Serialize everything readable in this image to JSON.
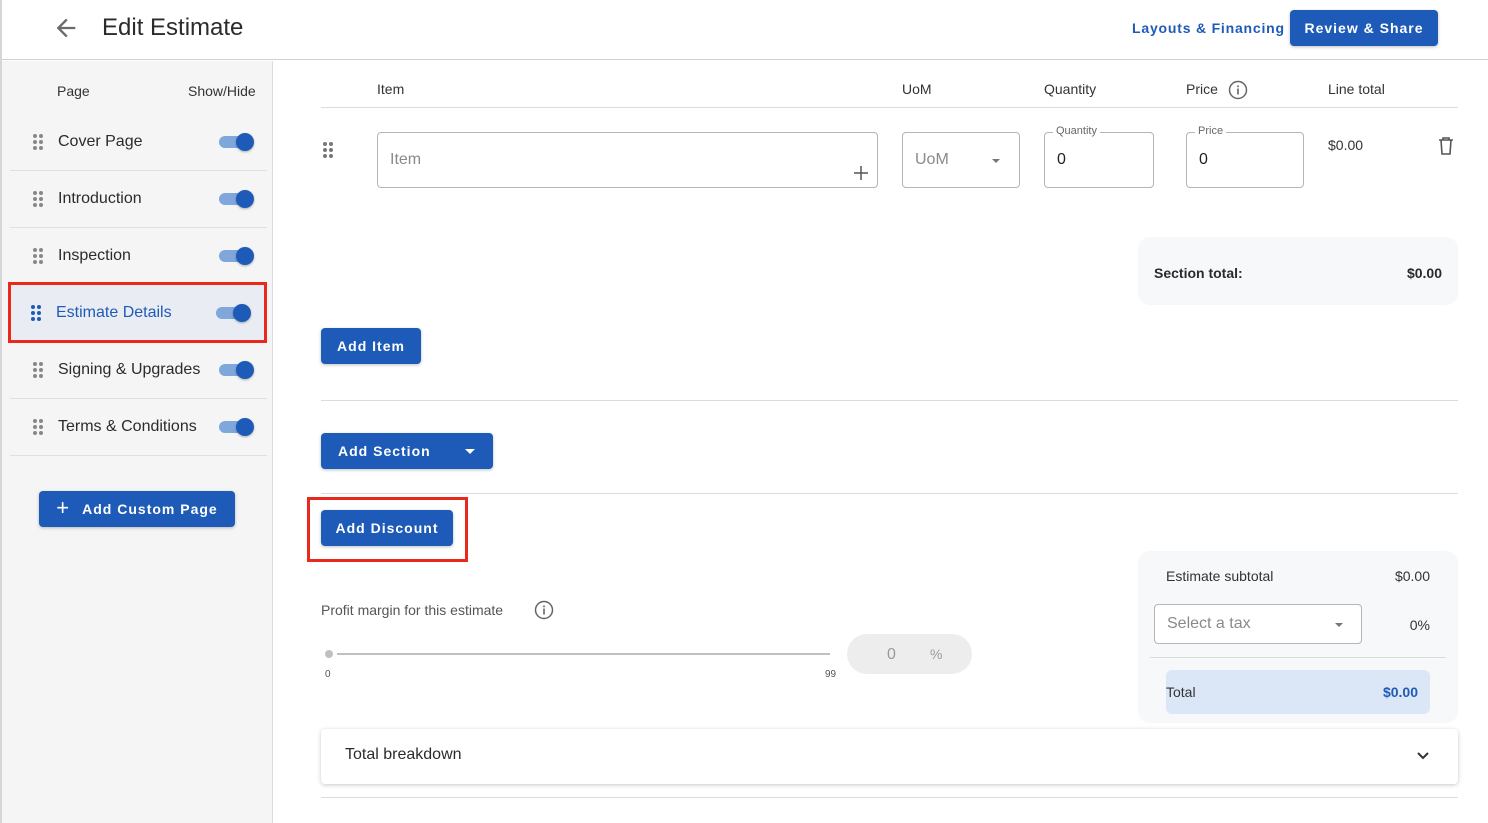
{
  "header": {
    "title": "Edit Estimate",
    "layouts_label": "Layouts & Financing",
    "review_label": "Review & Share",
    "accent": "#1e5bb8"
  },
  "sidebar": {
    "col_page": "Page",
    "col_show_hide": "Show/Hide",
    "items": [
      {
        "label": "Cover Page",
        "enabled": true
      },
      {
        "label": "Introduction",
        "enabled": true
      },
      {
        "label": "Inspection",
        "enabled": true
      },
      {
        "label": "Estimate Details",
        "enabled": true,
        "active": true
      },
      {
        "label": "Signing & Upgrades",
        "enabled": true
      },
      {
        "label": "Terms & Conditions",
        "enabled": true
      }
    ],
    "add_custom_label": "Add Custom Page"
  },
  "table": {
    "headers": {
      "item": "Item",
      "uom": "UoM",
      "quantity": "Quantity",
      "price": "Price",
      "line_total": "Line total"
    },
    "row": {
      "item_placeholder": "Item",
      "uom_placeholder": "UoM",
      "quantity_legend": "Quantity",
      "quantity_value": "0",
      "price_legend": "Price",
      "price_value": "0",
      "line_total": "$0.00"
    },
    "section_total_label": "Section total:",
    "section_total_value": "$0.00"
  },
  "actions": {
    "add_item": "Add Item",
    "add_section": "Add Section",
    "add_discount": "Add Discount"
  },
  "profit": {
    "label": "Profit margin for this estimate",
    "min": "0",
    "max": "99",
    "value": "0",
    "unit": "%"
  },
  "summary": {
    "subtotal_label": "Estimate subtotal",
    "subtotal_value": "$0.00",
    "tax_placeholder": "Select a tax",
    "tax_value": "0%",
    "total_label": "Total",
    "total_value": "$0.00"
  },
  "breakdown": {
    "label": "Total breakdown"
  }
}
